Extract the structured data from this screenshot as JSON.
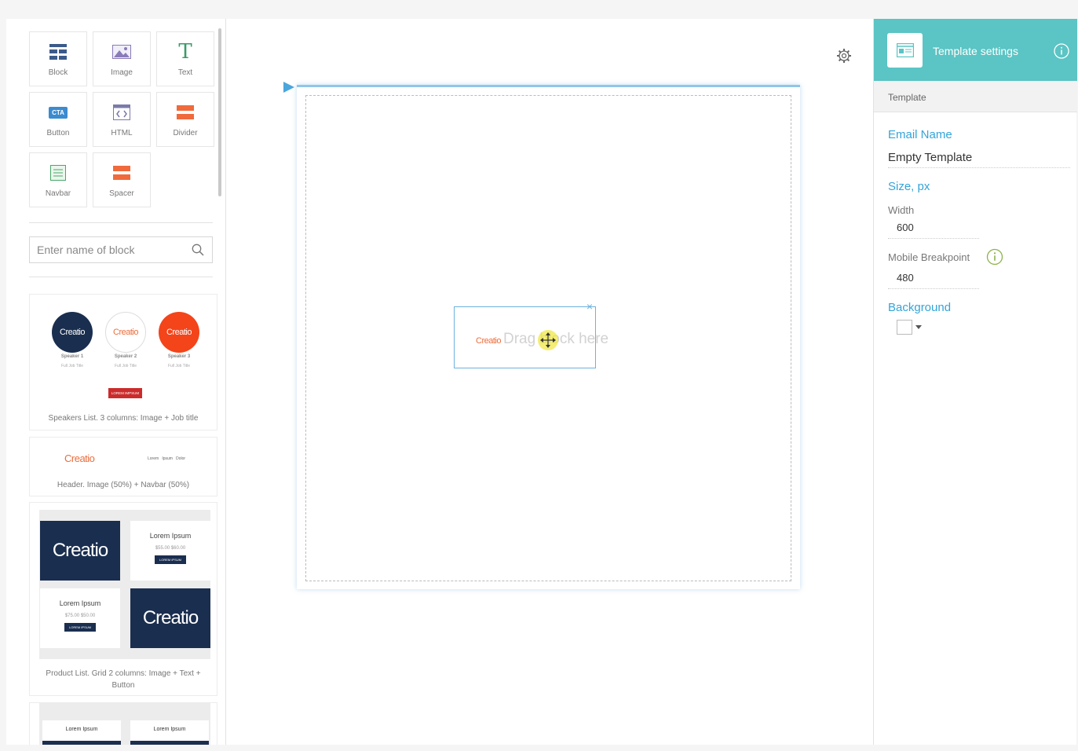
{
  "toolbox": {
    "tiles": [
      {
        "label": "Block",
        "icon": "block-grid-icon"
      },
      {
        "label": "Image",
        "icon": "image-icon"
      },
      {
        "label": "Text",
        "icon": "text-T-icon"
      },
      {
        "label": "Button",
        "icon": "cta-button-icon"
      },
      {
        "label": "HTML",
        "icon": "html-code-icon"
      },
      {
        "label": "Divider",
        "icon": "divider-icon"
      },
      {
        "label": "Navbar",
        "icon": "navbar-icon"
      },
      {
        "label": "Spacer",
        "icon": "spacer-icon"
      }
    ],
    "search": {
      "placeholder": "Enter name of block",
      "icon": "search-icon"
    }
  },
  "blocks": {
    "speakers": {
      "caption": "Speakers List. 3 columns: Image + Job title",
      "speakers": [
        {
          "brand": "Creatio",
          "name": "Speaker 1",
          "job": "Full Job Title"
        },
        {
          "brand": "Creatio",
          "name": "Speaker 2",
          "job": "Full Job Title"
        },
        {
          "brand": "Creatio",
          "name": "Speaker 3",
          "job": "Full Job Title"
        }
      ],
      "button": "LOREM IMPSUM"
    },
    "header": {
      "caption": "Header. Image (50%) + Navbar (50%)",
      "brand": "Creatio",
      "nav": "Lorem   Ipsum   Dolor"
    },
    "product": {
      "caption": "Product List. Grid 2 columns: Image + Text + Button",
      "brand": "Creatio",
      "items": [
        {
          "title": "Lorem Ipsum",
          "price": "$55.00 $60.00",
          "button": "LOREM IPSUM"
        },
        {
          "title": "Lorem Ipsum",
          "price": "$75.00 $50.00",
          "button": "LOREM IPSUM"
        }
      ]
    },
    "partial": {
      "items": [
        "Lorem Ipsum",
        "Lorem Ipsum"
      ]
    }
  },
  "canvas": {
    "drop": {
      "brand": "Creatio",
      "ghost_text": "Drag block here",
      "close": "×"
    },
    "icons": {
      "settings": "gear-icon",
      "move": "move-cursor-icon"
    }
  },
  "settings": {
    "header_title": "Template settings",
    "subheader": "Template",
    "email_name_label": "Email Name",
    "email_name_value": "Empty Template",
    "size_label": "Size, px",
    "width_label": "Width",
    "width_value": "600",
    "breakpoint_label": "Mobile Breakpoint",
    "breakpoint_value": "480",
    "background_label": "Background"
  },
  "colors": {
    "accent_teal": "#5bc4c4",
    "link_blue": "#33a4d8",
    "brand_orange": "#ec6d3b",
    "navy": "#1a2e4f",
    "red": "#cc2b2b"
  }
}
